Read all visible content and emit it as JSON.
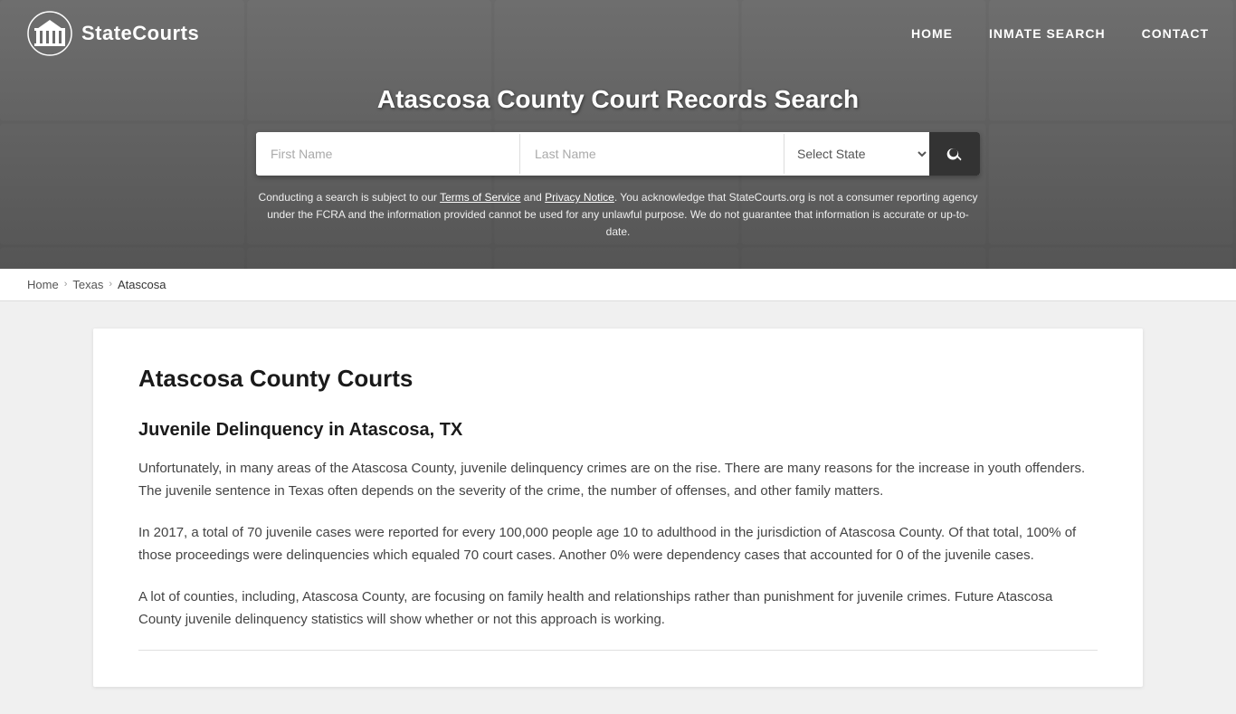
{
  "site": {
    "logo_text": "StateCourts",
    "logo_alt": "StateCourts Logo"
  },
  "navbar": {
    "home_label": "HOME",
    "inmate_search_label": "INMATE SEARCH",
    "contact_label": "CONTACT"
  },
  "hero": {
    "title": "Atascosa County Court Records Search",
    "search": {
      "first_name_placeholder": "First Name",
      "last_name_placeholder": "Last Name",
      "state_placeholder": "Select State",
      "search_button_label": "Search"
    },
    "disclaimer_text_1": "Conducting a search is subject to our ",
    "disclaimer_tos": "Terms of Service",
    "disclaimer_and": " and ",
    "disclaimer_privacy": "Privacy Notice",
    "disclaimer_text_2": ". You acknowledge that StateCourts.org is not a consumer reporting agency under the FCRA and the information provided cannot be used for any unlawful purpose. We do not guarantee that information is accurate or up-to-date."
  },
  "breadcrumb": {
    "home": "Home",
    "state": "Texas",
    "county": "Atascosa"
  },
  "content": {
    "page_title": "Atascosa County Courts",
    "section1_title": "Juvenile Delinquency in Atascosa, TX",
    "para1": "Unfortunately, in many areas of the Atascosa County, juvenile delinquency crimes are on the rise. There are many reasons for the increase in youth offenders. The juvenile sentence in Texas often depends on the severity of the crime, the number of offenses, and other family matters.",
    "para2": "In 2017, a total of 70 juvenile cases were reported for every 100,000 people age 10 to adulthood in the jurisdiction of Atascosa County. Of that total, 100% of those proceedings were delinquencies which equaled 70 court cases. Another 0% were dependency cases that accounted for 0 of the juvenile cases.",
    "para3": "A lot of counties, including, Atascosa County, are focusing on family health and relationships rather than punishment for juvenile crimes. Future Atascosa County juvenile delinquency statistics will show whether or not this approach is working."
  }
}
